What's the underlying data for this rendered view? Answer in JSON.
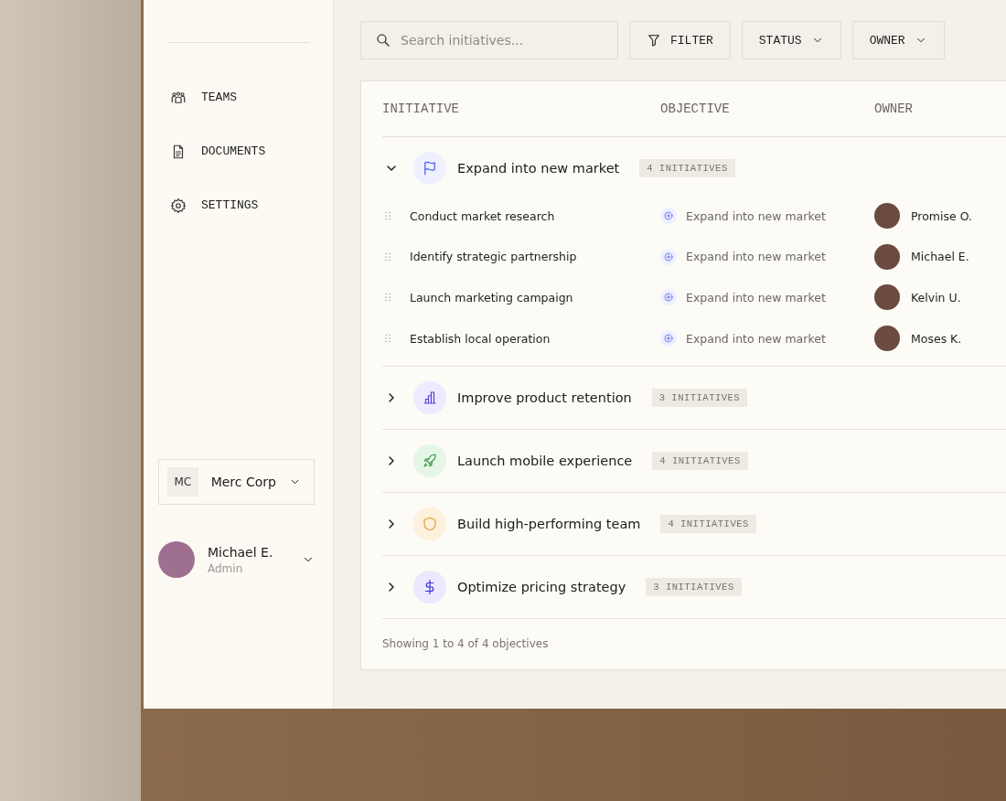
{
  "sidebar": {
    "items": [
      {
        "kind": "teams",
        "label": "TEAMS",
        "selected": false
      },
      {
        "kind": "documents",
        "label": "DOCUMENTS",
        "selected": false
      },
      {
        "kind": "settings",
        "label": "SETTINGS",
        "selected": false
      }
    ],
    "workspace": {
      "initials": "MC",
      "name": "Merc Corp"
    },
    "user": {
      "name": "Michael E.",
      "role": "Admin"
    }
  },
  "toolbar": {
    "search": {
      "placeholder": "Search initiatives..."
    },
    "buttons": [
      {
        "kind": "filter",
        "label": "FILTER"
      },
      {
        "kind": "dropdown",
        "label": "STATUS"
      },
      {
        "kind": "dropdown",
        "label": "OWNER"
      }
    ]
  },
  "table": {
    "columns": [
      "INITIATIVE",
      "OBJECTIVE",
      "OWNER"
    ],
    "objectives": [
      {
        "kind": "flag",
        "color": "#eef0ff",
        "title": "Expand into new market",
        "count": "4 INITIATIVES",
        "expanded": true,
        "initiatives": [
          {
            "name": "Conduct market research",
            "objective": "Expand into new market",
            "owner": "Promise O."
          },
          {
            "name": "Identify strategic partnership",
            "objective": "Expand into new market",
            "owner": "Michael E."
          },
          {
            "name": "Launch marketing campaign",
            "objective": "Expand into new market",
            "owner": "Kelvin U."
          },
          {
            "name": "Establish local operation",
            "objective": "Expand into new market",
            "owner": "Moses K."
          }
        ]
      },
      {
        "kind": "chart",
        "color": "#efeaff",
        "title": "Improve product retention",
        "count": "3 INITIATIVES",
        "expanded": false
      },
      {
        "kind": "rocket",
        "color": "#e6f6e6",
        "title": "Launch mobile experience",
        "count": "4 INITIATIVES",
        "expanded": false
      },
      {
        "kind": "shield",
        "color": "#fdf0dc",
        "title": "Build high-performing team",
        "count": "4 INITIATIVES",
        "expanded": false
      },
      {
        "kind": "dollar",
        "color": "#ece8ff",
        "title": "Optimize pricing strategy",
        "count": "3 INITIATIVES",
        "expanded": false
      }
    ],
    "footer": "Showing 1 to 4 of 4 objectives"
  }
}
